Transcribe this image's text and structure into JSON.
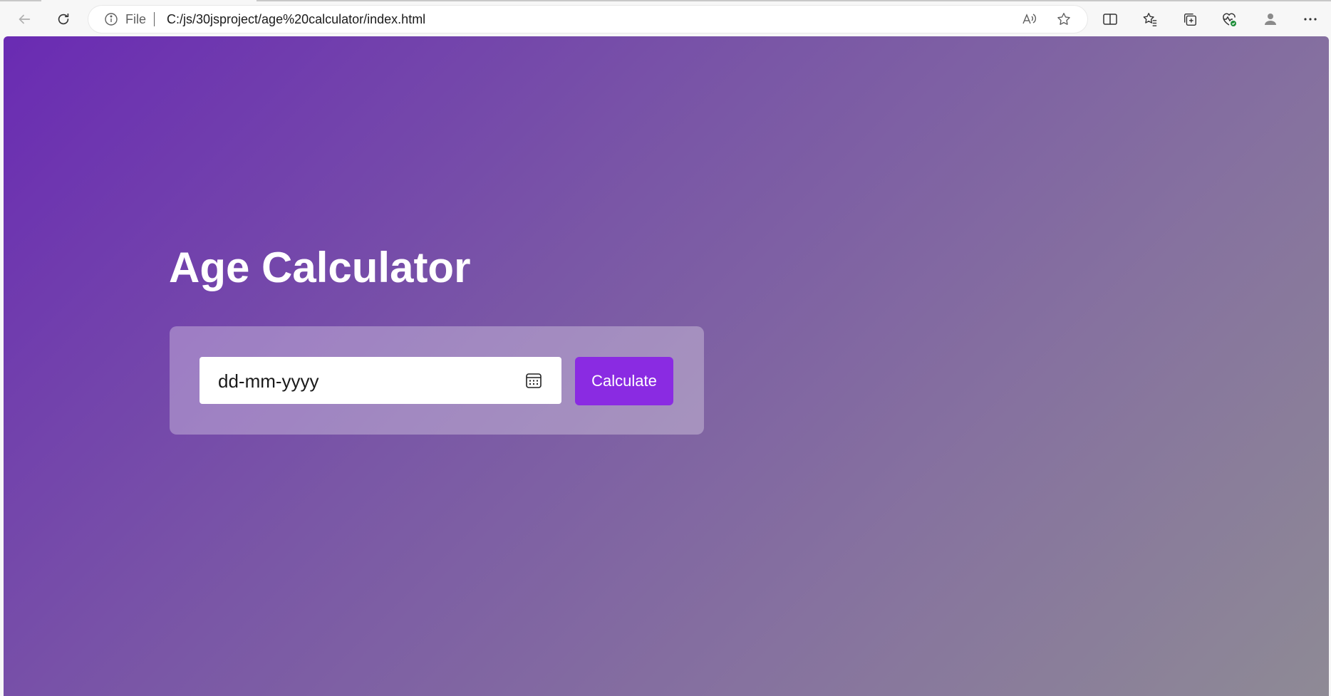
{
  "browser": {
    "file_label": "File",
    "url": "C:/js/30jsproject/age%20calculator/index.html"
  },
  "page": {
    "title": "Age Calculator",
    "date_input": {
      "placeholder": "dd-mm-yyyy"
    },
    "calculate_label": "Calculate"
  },
  "colors": {
    "gradient_start": "#6a2bb3",
    "gradient_end": "#8e8a95",
    "button": "#8a2be2"
  }
}
